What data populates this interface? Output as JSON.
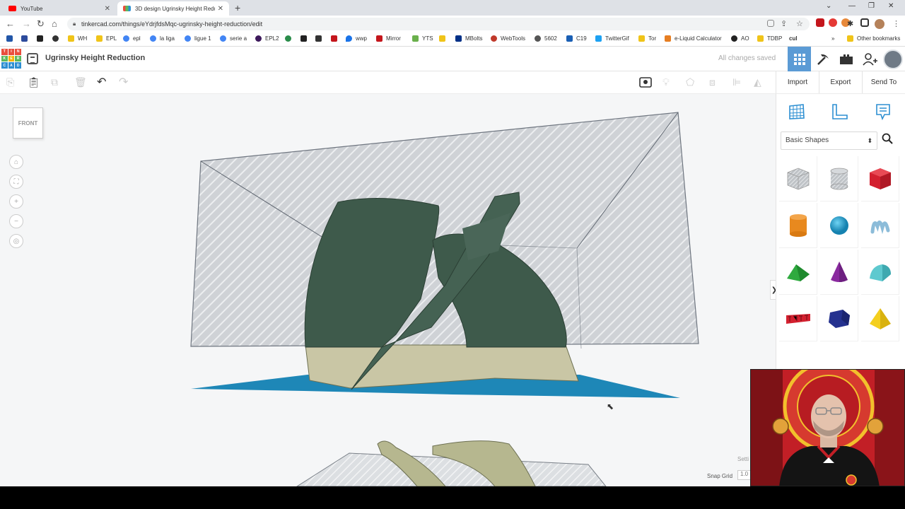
{
  "browser": {
    "tabs": [
      {
        "title": "YouTube",
        "active": false,
        "favicon_color": "#ff0000"
      },
      {
        "title": "3D design Ugrinsky Height Redu",
        "active": true,
        "favicon_color": "#e94e3d"
      }
    ],
    "url": "tinkercad.com/things/eYdrjfdsMqc-ugrinsky-height-reduction/edit",
    "bookmarks": [
      {
        "label": "WH",
        "color": "#f0c419"
      },
      {
        "label": "EPL",
        "color": "#f0c419"
      },
      {
        "label": "epl",
        "color": "#4285f4"
      },
      {
        "label": "la liga",
        "color": "#4285f4"
      },
      {
        "label": "ligue 1",
        "color": "#4285f4"
      },
      {
        "label": "serie a",
        "color": "#4285f4"
      },
      {
        "label": "EPL2",
        "color": "#3d195b"
      },
      {
        "label": "wwp",
        "color": "#1a73e8"
      },
      {
        "label": "Mirror",
        "color": "#c4161c"
      },
      {
        "label": "YTS",
        "color": "#6ab04c"
      },
      {
        "label": "MBolts",
        "color": "#003087"
      },
      {
        "label": "WebTools",
        "color": "#c0392b"
      },
      {
        "label": "5602",
        "color": "#555555"
      },
      {
        "label": "C19",
        "color": "#1a5fb4"
      },
      {
        "label": "TwitterGif",
        "color": "#1da1f2"
      },
      {
        "label": "Tor",
        "color": "#f0c419"
      },
      {
        "label": "e-Liquid Calculator",
        "color": "#e67e22"
      },
      {
        "label": "AO",
        "color": "#222222"
      },
      {
        "label": "TDBP",
        "color": "#f0c419"
      },
      {
        "label": "cul",
        "color": "#222222"
      }
    ],
    "other_bookmarks": "Other bookmarks"
  },
  "header": {
    "logo_letters": [
      "TIN",
      "KER",
      "CAD"
    ],
    "design_title": "Ugrinsky Height Reduction",
    "save_status": "All changes saved"
  },
  "actions": {
    "import": "Import",
    "export": "Export",
    "send_to": "Send To"
  },
  "workplane": {
    "viewcube_label": "FRONT",
    "snap_grid_label": "Snap Grid",
    "snap_grid_value": "1.0",
    "settings_label": "Setti"
  },
  "panel": {
    "shape_category": "Basic Shapes",
    "shapes": [
      {
        "name": "box-hole",
        "color": "#c8c8c8"
      },
      {
        "name": "cylinder-hole",
        "color": "#c8c8c8"
      },
      {
        "name": "box",
        "color": "#d3202f"
      },
      {
        "name": "cylinder",
        "color": "#e8891e"
      },
      {
        "name": "sphere",
        "color": "#1d9fd1"
      },
      {
        "name": "scribble",
        "color": "#8cbcd9"
      },
      {
        "name": "roof",
        "color": "#2faa3f"
      },
      {
        "name": "cone",
        "color": "#8a2a9f"
      },
      {
        "name": "round-roof",
        "color": "#5ec9cf"
      },
      {
        "name": "text",
        "color": "#d3202f"
      },
      {
        "name": "polygon",
        "color": "#24318f"
      },
      {
        "name": "pyramid",
        "color": "#f4cf1e"
      }
    ]
  }
}
